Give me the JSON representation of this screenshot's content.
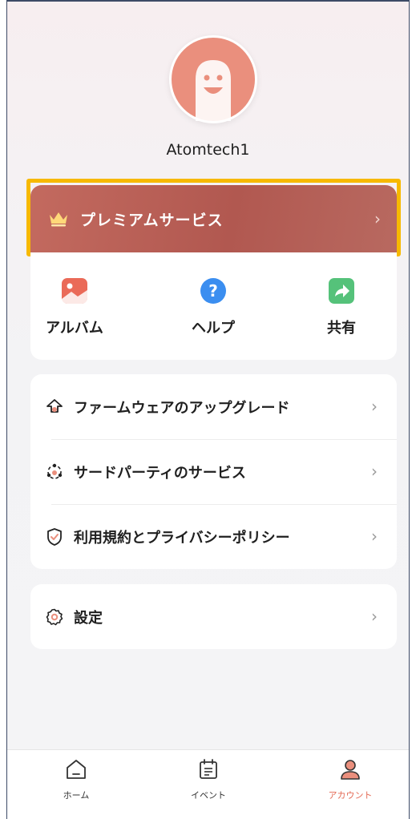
{
  "profile": {
    "username": "Atomtech1"
  },
  "premium": {
    "label": "プレミアムサービス",
    "chevron": "›"
  },
  "quick_actions": [
    {
      "label": "アルバム",
      "icon": "album-icon"
    },
    {
      "label": "ヘルプ",
      "icon": "help-icon"
    },
    {
      "label": "共有",
      "icon": "share-icon"
    }
  ],
  "menu": [
    {
      "label": "ファームウェアのアップグレード",
      "icon": "firmware-upgrade-icon",
      "chevron": "›"
    },
    {
      "label": "サードパーティのサービス",
      "icon": "third-party-icon",
      "chevron": "›"
    },
    {
      "label": "利用規約とプライバシーポリシー",
      "icon": "shield-check-icon",
      "chevron": "›"
    }
  ],
  "settings": {
    "label": "設定",
    "icon": "gear-icon",
    "chevron": "›"
  },
  "tabbar": [
    {
      "label": "ホーム",
      "icon": "home-icon",
      "active": false
    },
    {
      "label": "イベント",
      "icon": "calendar-icon",
      "active": false
    },
    {
      "label": "アカウント",
      "icon": "account-icon",
      "active": true
    }
  ],
  "colors": {
    "premium_bg": "#b85a51",
    "highlight": "#f7b900",
    "accent": "#e46a55",
    "album_icon": "#ea6a58",
    "help_icon": "#3b8ef0",
    "share_icon": "#55c27a"
  }
}
